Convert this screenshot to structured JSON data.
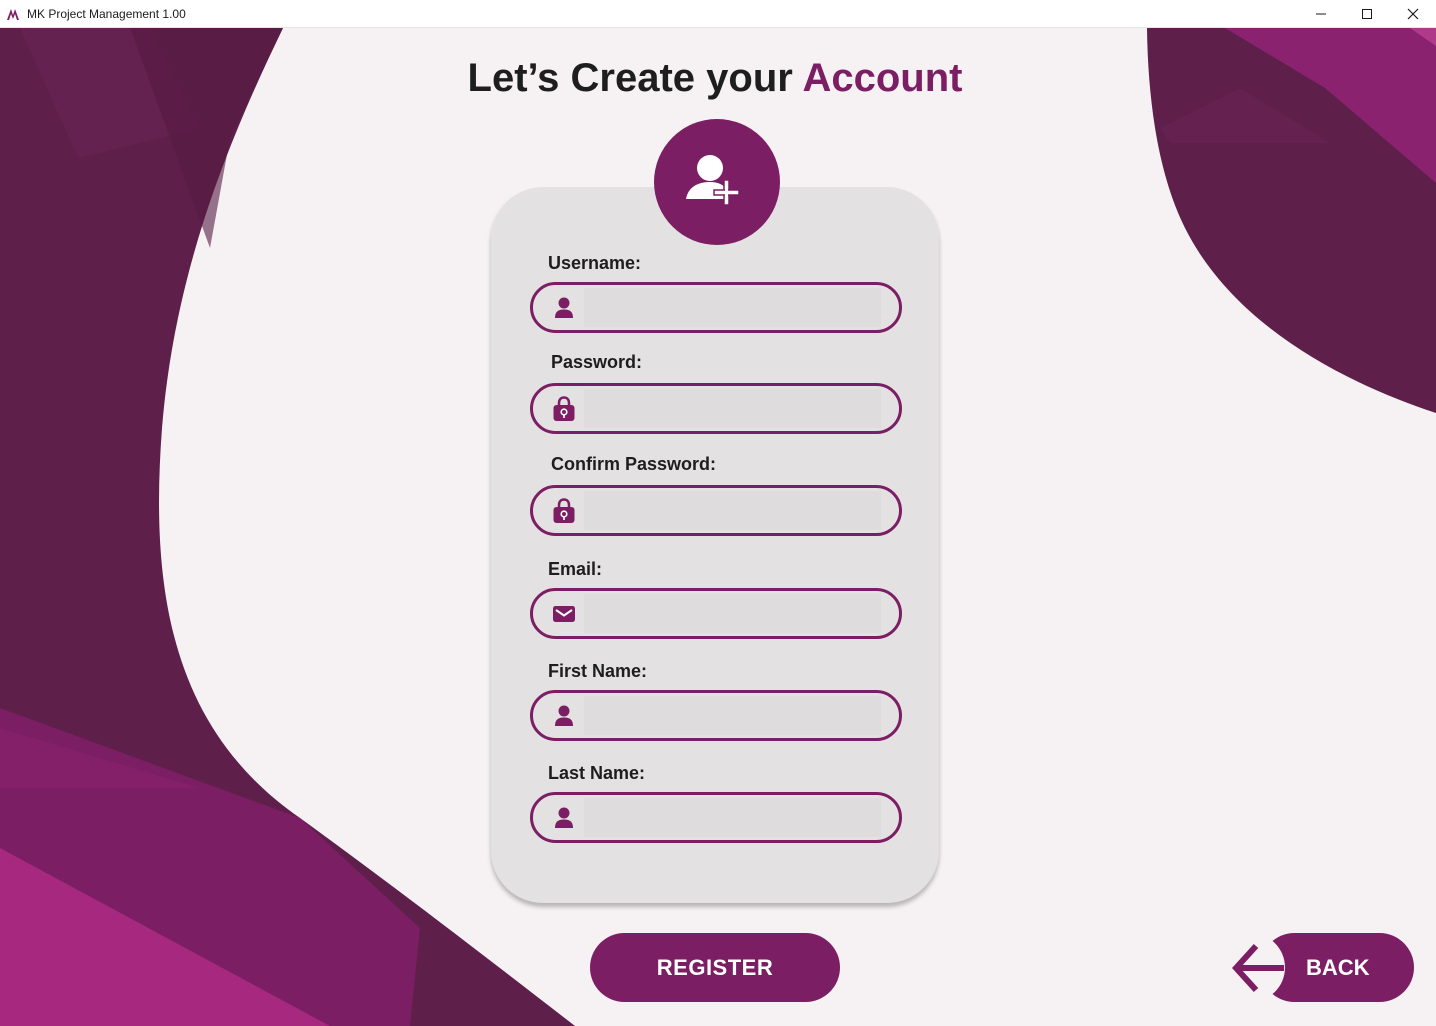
{
  "window": {
    "title": "MK Project Management 1.00"
  },
  "page": {
    "title_prefix": "Let’s Create your ",
    "title_accent": "Account"
  },
  "form": {
    "fields": [
      {
        "label": "Username:",
        "icon": "user-icon",
        "value": ""
      },
      {
        "label": "Password:",
        "icon": "lock-icon",
        "value": ""
      },
      {
        "label": "Confirm Password:",
        "icon": "lock-icon",
        "value": ""
      },
      {
        "label": "Email:",
        "icon": "mail-icon",
        "value": ""
      },
      {
        "label": "First Name:",
        "icon": "user-icon",
        "value": ""
      },
      {
        "label": "Last Name:",
        "icon": "user-icon",
        "value": ""
      }
    ]
  },
  "buttons": {
    "register": "REGISTER",
    "back": "BACK"
  },
  "colors": {
    "accent": "#7b1e63",
    "card": "#e3e1e2",
    "background": "#f6f2f4"
  }
}
